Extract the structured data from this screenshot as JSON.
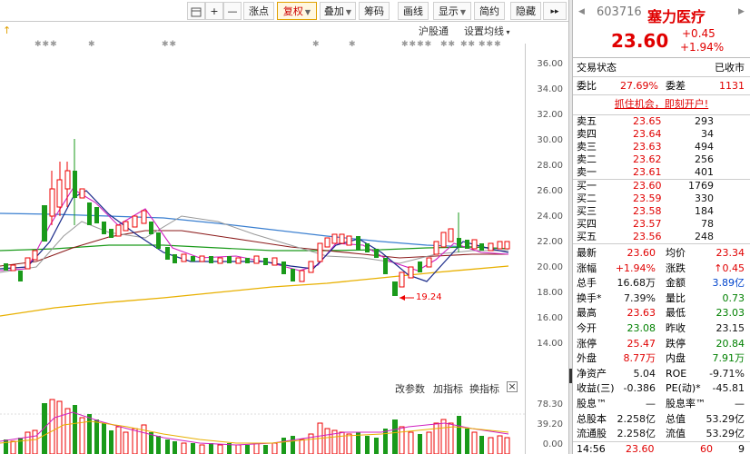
{
  "toolbar": {
    "plus": "+",
    "minus": "—",
    "buttons": [
      {
        "label": "叠加",
        "caret": true
      },
      {
        "label": "筹码",
        "caret": false
      },
      {
        "label": "画线",
        "caret": false
      },
      {
        "label": "显示",
        "caret": true
      },
      {
        "label": "简约",
        "caret": false
      },
      {
        "label": "隐藏",
        "caret": false
      }
    ],
    "btn_huitu": "画线",
    "btn_zhanghu": "涨点",
    "btn_fuquan": "复权",
    "more": "▸▸"
  },
  "chart": {
    "hgt_label": "沪股通",
    "ma_label": "设置均线",
    "arrow_up": "↑",
    "low_annotation": "19.24",
    "price_ticks": [
      "36.00",
      "34.00",
      "32.00",
      "30.00",
      "28.00",
      "26.00",
      "24.00",
      "22.00",
      "20.00",
      "18.00",
      "16.00",
      "14.00"
    ],
    "vol_ticks": [
      "78.30",
      "39.20",
      "0.00"
    ],
    "vol_header": {
      "param": "改参数",
      "add": "加指标",
      "switch": "换指标",
      "close": "×"
    },
    "stars": [
      "✱✱✱",
      "✱",
      "✱✱",
      "✱",
      "✱",
      "✱✱✱✱",
      "✱✱",
      "✱✱",
      "✱✱✱"
    ]
  },
  "panel": {
    "code": "603716",
    "name": "塞力医疗",
    "price": "23.60",
    "change": "+0.45",
    "change_pct": "+1.94%",
    "trade_status_label": "交易状态",
    "trade_status": "已收市",
    "weibi_label": "委比",
    "weibi": "27.69%",
    "weicha_label": "委差",
    "weicha": "1131",
    "promo": "抓住机会，即刻开户!",
    "asks": [
      {
        "label": "卖五",
        "price": "23.65",
        "vol": "293"
      },
      {
        "label": "卖四",
        "price": "23.64",
        "vol": "34"
      },
      {
        "label": "卖三",
        "price": "23.63",
        "vol": "494"
      },
      {
        "label": "卖二",
        "price": "23.62",
        "vol": "256"
      },
      {
        "label": "卖一",
        "price": "23.61",
        "vol": "401"
      }
    ],
    "bids": [
      {
        "label": "买一",
        "price": "23.60",
        "vol": "1769"
      },
      {
        "label": "买二",
        "price": "23.59",
        "vol": "330"
      },
      {
        "label": "买三",
        "price": "23.58",
        "vol": "184"
      },
      {
        "label": "买四",
        "price": "23.57",
        "vol": "78"
      },
      {
        "label": "买五",
        "price": "23.56",
        "vol": "248"
      }
    ],
    "stats": [
      {
        "l1": "最新",
        "v1": "23.60",
        "c1": "red",
        "l2": "均价",
        "v2": "23.34",
        "c2": "red"
      },
      {
        "l1": "涨幅",
        "v1": "+1.94%",
        "c1": "red",
        "l2": "涨跌",
        "v2": "↑0.45",
        "c2": "red"
      },
      {
        "l1": "总手",
        "v1": "16.68万",
        "c1": "dark",
        "l2": "金额",
        "v2": "3.89亿",
        "c2": "blue"
      },
      {
        "l1": "换手*",
        "v1": "7.39%",
        "c1": "dark",
        "l2": "量比",
        "v2": "0.73",
        "c2": "green"
      },
      {
        "l1": "最高",
        "v1": "23.63",
        "c1": "red",
        "l2": "最低",
        "v2": "23.03",
        "c2": "green"
      },
      {
        "l1": "今开",
        "v1": "23.08",
        "c1": "green",
        "l2": "昨收",
        "v2": "23.15",
        "c2": "dark"
      },
      {
        "l1": "涨停",
        "v1": "25.47",
        "c1": "red",
        "l2": "跌停",
        "v2": "20.84",
        "c2": "green"
      },
      {
        "l1": "外盘",
        "v1": "8.77万",
        "c1": "red",
        "l2": "内盘",
        "v2": "7.91万",
        "c2": "green"
      },
      {
        "l1": "净资产",
        "v1": "5.04",
        "c1": "dark",
        "l2": "ROE",
        "v2": "-9.71%",
        "c2": "dark"
      },
      {
        "l1": "收益(三)",
        "v1": "-0.386",
        "c1": "dark",
        "l2": "PE(动)*",
        "v2": "-45.81",
        "c2": "dark"
      },
      {
        "l1": "股息™",
        "v1": "—",
        "c1": "dark",
        "l2": "股息率™",
        "v2": "—",
        "c2": "dark"
      },
      {
        "l1": "总股本",
        "v1": "2.258亿",
        "c1": "dark",
        "l2": "总值",
        "v2": "53.29亿",
        "c2": "dark"
      },
      {
        "l1": "流通股",
        "v1": "2.258亿",
        "c1": "dark",
        "l2": "流值",
        "v2": "53.29亿",
        "c2": "dark"
      }
    ],
    "tick": {
      "time": "14:56",
      "price": "23.60",
      "vol": "60",
      "n": "9"
    }
  }
}
